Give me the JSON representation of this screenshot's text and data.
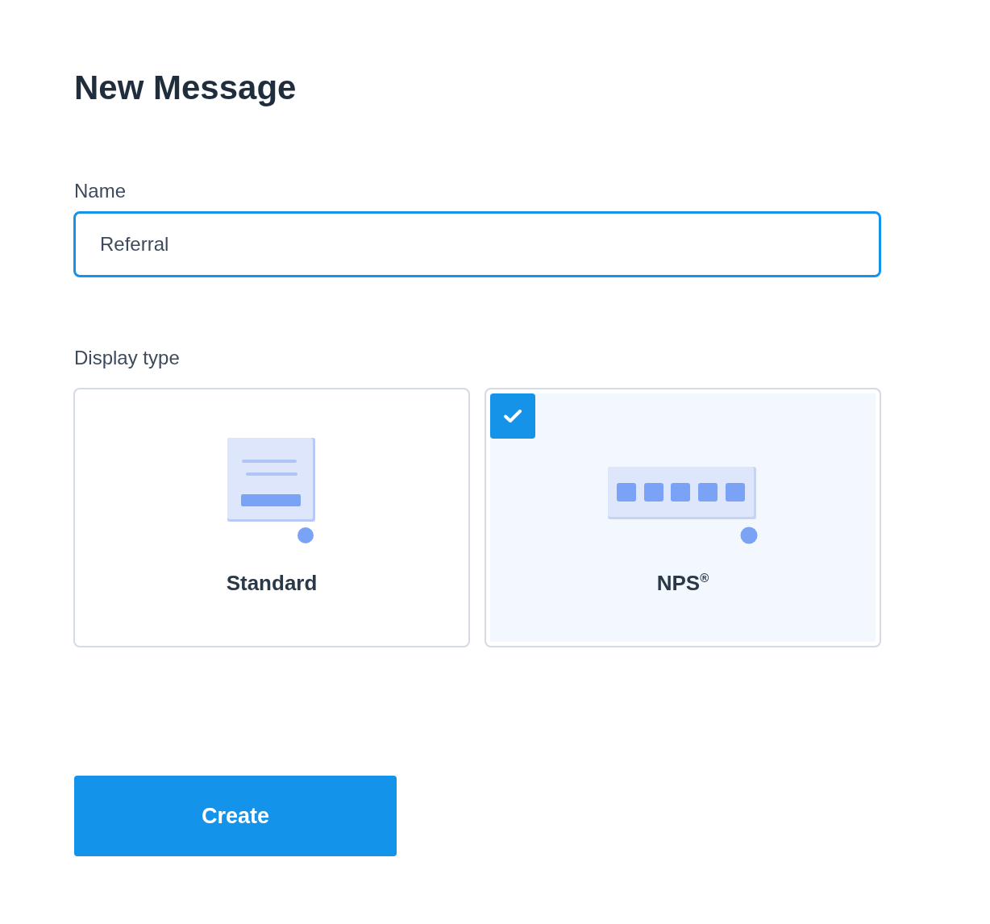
{
  "title": "New Message",
  "name_field": {
    "label": "Name",
    "value": "Referral",
    "focused": true
  },
  "display_type": {
    "label": "Display type",
    "options": [
      {
        "kind": "standard",
        "label": "Standard",
        "selected": false
      },
      {
        "kind": "nps",
        "label": "NPS$^{®}$",
        "selected": true
      }
    ]
  },
  "create_button": {
    "label": "Create"
  }
}
